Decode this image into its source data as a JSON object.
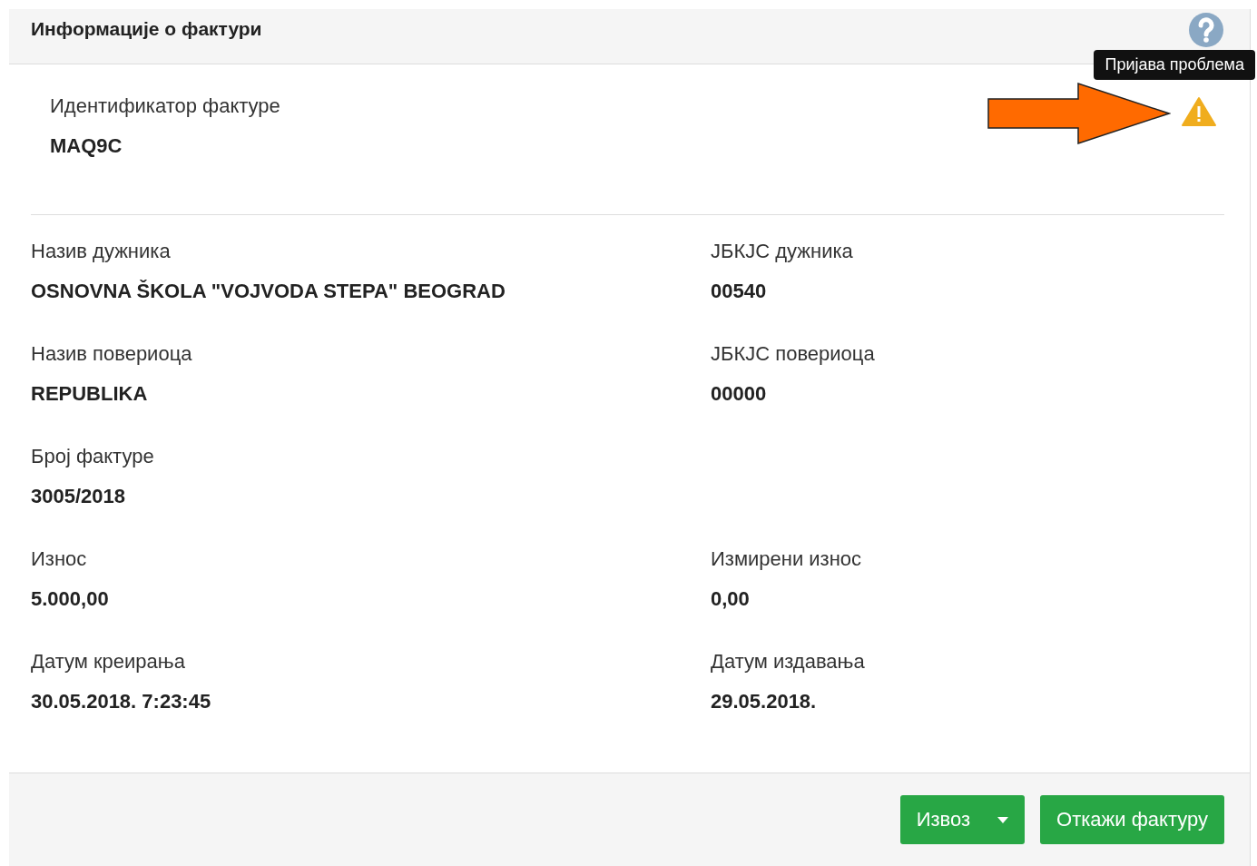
{
  "header": {
    "title": "Информације о фактури"
  },
  "tooltip": {
    "text": "Пријава проблема"
  },
  "identifier": {
    "label": "Идентификатор фактуре",
    "value": "MAQ9C"
  },
  "rows": [
    {
      "cells": [
        {
          "label": "Назив дужника",
          "value": "OSNOVNA ŠKOLA \"VOJVODA STEPA\" BEOGRAD"
        },
        {
          "label": "ЈБКЈС дужника",
          "value": "00540"
        }
      ]
    },
    {
      "cells": [
        {
          "label": "Назив повериоца",
          "value": "REPUBLIKA"
        },
        {
          "label": "ЈБКЈС повериоца",
          "value": "00000"
        }
      ]
    },
    {
      "cells": [
        {
          "label": "Број фактуре",
          "value": "3005/2018"
        }
      ]
    },
    {
      "cells": [
        {
          "label": "Износ",
          "value": "5.000,00"
        },
        {
          "label": "Измирени износ",
          "value": "0,00"
        }
      ]
    },
    {
      "cells": [
        {
          "label": "Датум креирања",
          "value": "30.05.2018. 7:23:45"
        },
        {
          "label": "Датум издавања",
          "value": "29.05.2018."
        }
      ]
    }
  ],
  "footer": {
    "buttons": [
      {
        "label": "Извоз",
        "kind": "split"
      },
      {
        "label": "Откажи фактуру",
        "kind": "plain"
      }
    ]
  }
}
